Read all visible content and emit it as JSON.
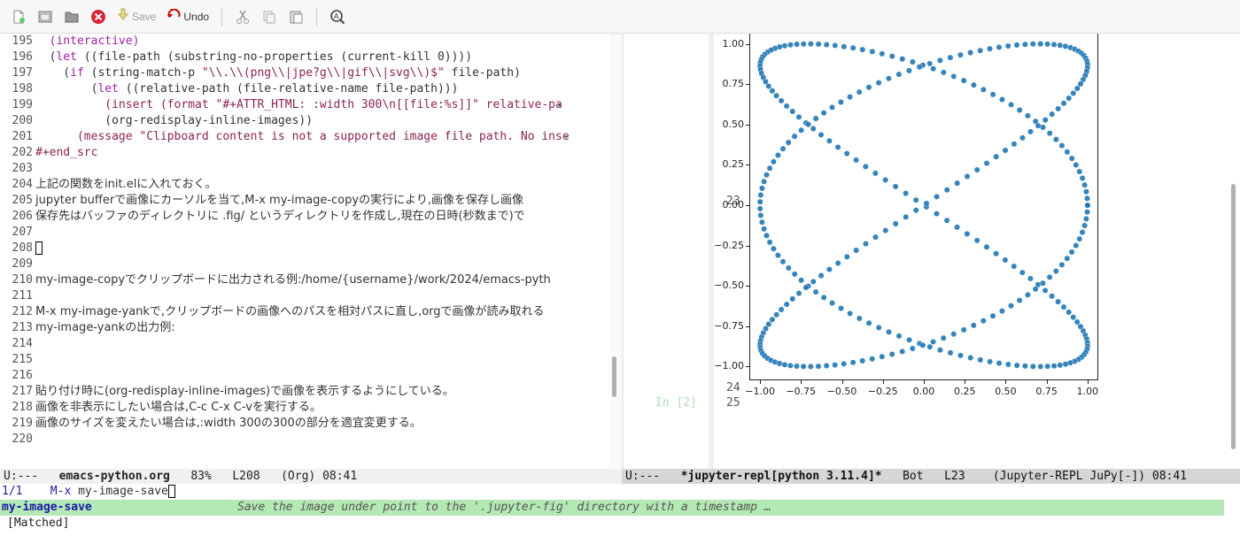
{
  "toolbar": {
    "save_label": "Save",
    "undo_label": "Undo",
    "icons": [
      "new-file-icon",
      "open-folder-icon",
      "directory-icon",
      "close-buffer-icon",
      "save-icon",
      "undo-icon",
      "cut-icon",
      "copy-icon",
      "paste-icon",
      "search-icon"
    ]
  },
  "left_editor": {
    "lines": [
      {
        "num": "195",
        "text": "  (interactive)"
      },
      {
        "num": "196",
        "text": "  (let ((file-path (substring-no-properties (current-kill 0))))"
      },
      {
        "num": "197",
        "text": "    (if (string-match-p \"\\\\.\\\\(png\\\\|jpe?g\\\\|gif\\\\|svg\\\\)$\" file-path)"
      },
      {
        "num": "198",
        "text": "        (let ((relative-path (file-relative-name file-path)))"
      },
      {
        "num": "199",
        "text": "          (insert (format \"#+ATTR_HTML: :width 300\\n[[file:%s]]\" relative-pa"
      },
      {
        "num": "200",
        "text": "          (org-redisplay-inline-images))"
      },
      {
        "num": "201",
        "text": "      (message \"Clipboard content is not a supported image file path. No inse"
      },
      {
        "num": "202",
        "text": "#+end_src"
      },
      {
        "num": "203",
        "text": ""
      },
      {
        "num": "204",
        "text": "上記の関数をinit.elに入れておく。"
      },
      {
        "num": "205",
        "text": "jupyter bufferで画像にカーソルを当て,M-x my-image-copyの実行により,画像を保存し画像"
      },
      {
        "num": "206",
        "text": "保存先はバッファのディレクトリに .fig/ というディレクトリを作成し,現在の日時(秒数まで)で"
      },
      {
        "num": "207",
        "text": ""
      },
      {
        "num": "208",
        "text": ""
      },
      {
        "num": "209",
        "text": ""
      },
      {
        "num": "210",
        "text": "my-image-copyでクリップボードに出力される例:/home/{username}/work/2024/emacs-pyth"
      },
      {
        "num": "211",
        "text": ""
      },
      {
        "num": "212",
        "text": "M-x my-image-yankで,クリップボードの画像へのパスを相対パスに直し,orgで画像が読み取れる"
      },
      {
        "num": "213",
        "text": "my-image-yankの出力例:"
      },
      {
        "num": "214",
        "text": ""
      },
      {
        "num": "215",
        "text": ""
      },
      {
        "num": "216",
        "text": ""
      },
      {
        "num": "217",
        "text": "貼り付け時に(org-redisplay-inline-images)で画像を表示するようにしている。"
      },
      {
        "num": "218",
        "text": "画像を非表示にしたい場合は,C-c C-x C-vを実行する。"
      },
      {
        "num": "219",
        "text": "画像のサイズを変えたい場合は,:width 300の300の部分を適宜変更する。"
      },
      {
        "num": "220",
        "text": ""
      }
    ]
  },
  "right_repl": {
    "line_23": "23",
    "line_24": "24",
    "line_25": "25",
    "in_prompt": "In [2]"
  },
  "chart_data": {
    "type": "scatter",
    "title": "",
    "xlabel": "",
    "ylabel": "",
    "xlim": [
      -1.06,
      1.06
    ],
    "ylim": [
      -1.08,
      1.08
    ],
    "x_ticks": [
      "−1.00",
      "−0.75",
      "−0.50",
      "−0.25",
      "0.00",
      "0.25",
      "0.50",
      "0.75",
      "1.00"
    ],
    "y_ticks": [
      "1.00",
      "0.75",
      "0.50",
      "0.25",
      "0.00",
      "−0.25",
      "−0.50",
      "−0.75",
      "−1.00"
    ],
    "x_tick_values": [
      -1.0,
      -0.75,
      -0.5,
      -0.25,
      0.0,
      0.25,
      0.5,
      0.75,
      1.0
    ],
    "y_tick_values": [
      1.0,
      0.75,
      0.5,
      0.25,
      0.0,
      -0.25,
      -0.5,
      -0.75,
      -1.0
    ],
    "curve": "lissajous",
    "x_formula": "cos(3t)",
    "y_formula": "sin(2t)",
    "t_range": [
      0,
      6.283
    ],
    "num_points": 300,
    "marker_color": "#1f77b4",
    "grid": false
  },
  "modeline_left": {
    "status": "U:---",
    "buffer": "emacs-python.org",
    "percent": "83%",
    "line": "L208",
    "mode": "(Org) 08:41"
  },
  "modeline_right": {
    "status": "U:---",
    "buffer": "*jupyter-repl[python 3.11.4]*",
    "position": "Bot",
    "line": "L23",
    "mode": "(Jupyter-REPL JuPy[-]) 08:41"
  },
  "minibuffer": {
    "count": "1/1",
    "prompt": "M-x",
    "input": "my-image-save"
  },
  "completion": {
    "candidate": "my-image-save",
    "description": "Save the image under point to the '.jupyter-fig' directory with a timestamp …"
  },
  "matched_text": "[Matched]"
}
